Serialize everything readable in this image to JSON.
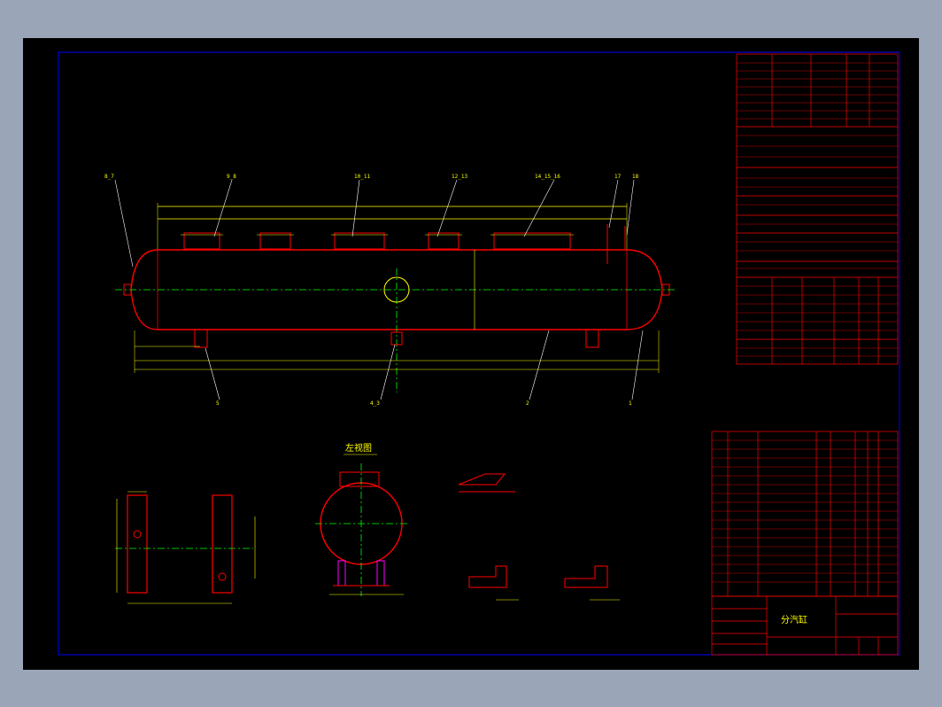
{
  "colors": {
    "background": "#000000",
    "frame_border": "#9aa6b8",
    "drawing_border": "#0000ff",
    "vessel_outline": "#ff0000",
    "dimension": "#ffff00",
    "centerline": "#00ff00",
    "text": "#ffff00",
    "leader": "#ffffff",
    "support": "#ff00ff"
  },
  "views": {
    "left_view_title": "左视图",
    "main_view": "分汽缸"
  },
  "title_block": {
    "name": "分汽缸"
  }
}
